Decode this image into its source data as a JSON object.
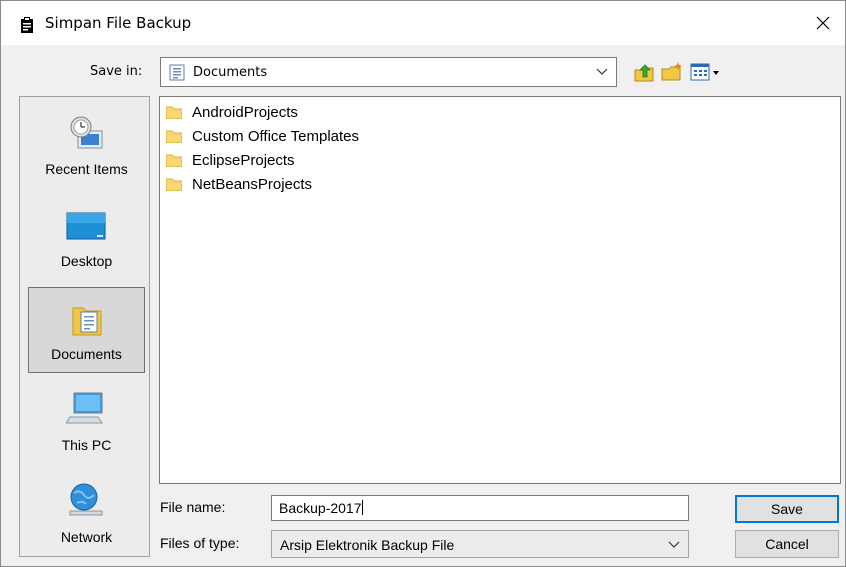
{
  "window": {
    "title": "Simpan File Backup"
  },
  "toolbar": {
    "save_in_label": "Save in:",
    "save_in_value": "Documents"
  },
  "places": [
    {
      "label": "Recent Items",
      "icon": "recent-items-icon"
    },
    {
      "label": "Desktop",
      "icon": "desktop-icon"
    },
    {
      "label": "Documents",
      "icon": "documents-icon",
      "selected": true
    },
    {
      "label": "This PC",
      "icon": "computer-icon"
    },
    {
      "label": "Network",
      "icon": "network-icon"
    }
  ],
  "files": [
    {
      "name": "AndroidProjects",
      "icon": "folder-icon"
    },
    {
      "name": "Custom Office Templates",
      "icon": "folder-icon"
    },
    {
      "name": "EclipseProjects",
      "icon": "folder-icon"
    },
    {
      "name": "NetBeansProjects",
      "icon": "folder-icon"
    }
  ],
  "form": {
    "file_name_label": "File name:",
    "file_name_value": "Backup-2017",
    "files_of_type_label": "Files of type:",
    "files_of_type_value": "Arsip Elektronik Backup File"
  },
  "buttons": {
    "save": "Save",
    "cancel": "Cancel"
  },
  "colors": {
    "accent": "#0078d7",
    "folder": "#f8d775",
    "desktop": "#1e90d6"
  }
}
